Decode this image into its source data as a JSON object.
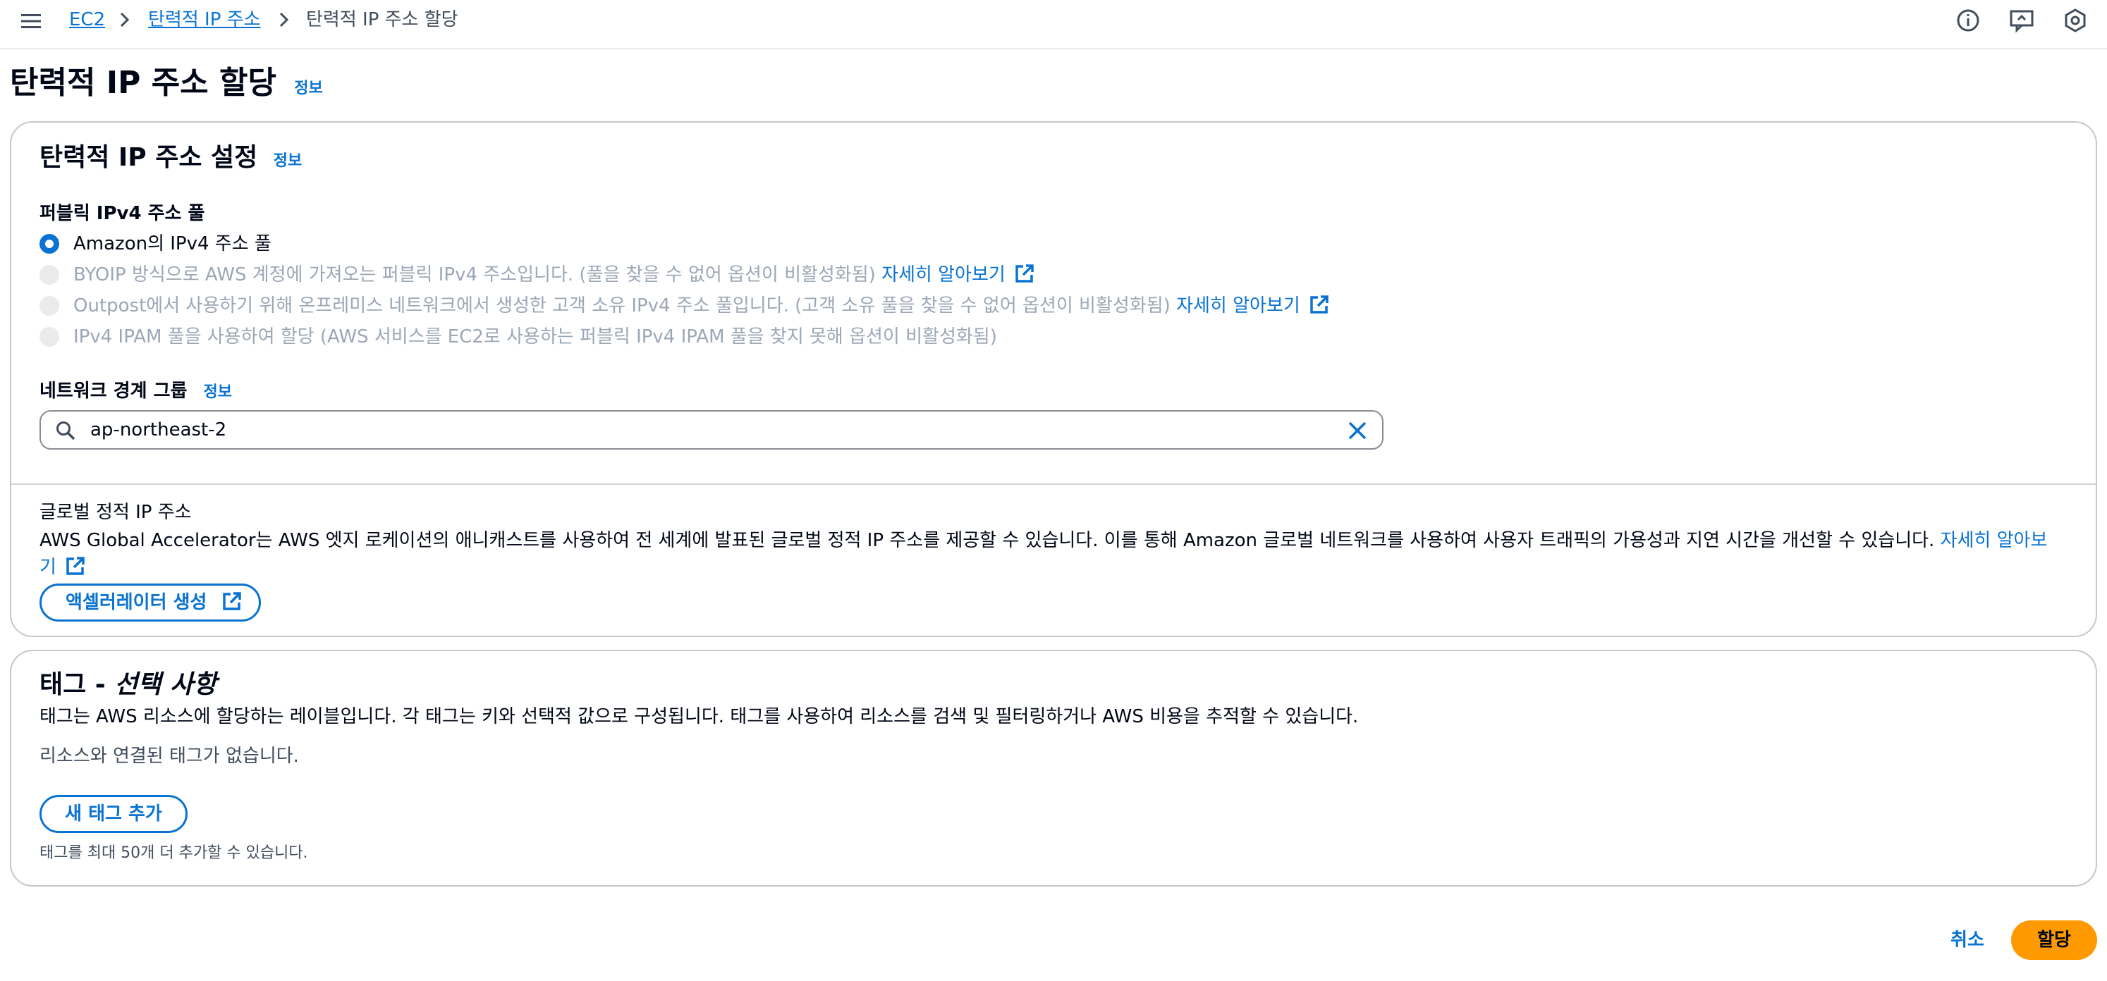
{
  "breadcrumb": {
    "items": [
      "EC2",
      "탄력적 IP 주소",
      "탄력적 IP 주소 할당"
    ]
  },
  "page": {
    "title": "탄력적 IP 주소 할당",
    "info": "정보"
  },
  "settings": {
    "title": "탄력적 IP 주소 설정",
    "info": "정보",
    "pool_label": "퍼블릭 IPv4 주소 풀",
    "options": [
      {
        "text": "Amazon의 IPv4 주소 풀",
        "selected": true,
        "disabled": false
      },
      {
        "text": "BYOIP 방식으로 AWS 계정에 가져오는 퍼블릭 IPv4 주소입니다. (풀을 찾을 수 없어 옵션이 비활성화됨)",
        "link": "자세히 알아보기",
        "selected": false,
        "disabled": true
      },
      {
        "text": "Outpost에서 사용하기 위해 온프레미스 네트워크에서 생성한 고객 소유 IPv4 주소 풀입니다. (고객 소유 풀을 찾을 수 없어 옵션이 비활성화됨)",
        "link": "자세히 알아보기",
        "selected": false,
        "disabled": true
      },
      {
        "text": "IPv4 IPAM 풀을 사용하여 할당 (AWS 서비스를 EC2로 사용하는 퍼블릭 IPv4 IPAM 풀을 찾지 못해 옵션이 비활성화됨)",
        "selected": false,
        "disabled": true
      }
    ],
    "nbg_label": "네트워크 경계 그룹",
    "nbg_info": "정보",
    "nbg_value": "ap-northeast-2",
    "global_title": "글로벌 정적 IP 주소",
    "global_desc": "AWS Global Accelerator는 AWS 엣지 로케이션의 애니캐스트를 사용하여 전 세계에 발표된 글로벌 정적 IP 주소를 제공할 수 있습니다. 이를 통해 Amazon 글로벌 네트워크를 사용하여 사용자 트래픽의 가용성과 지연 시간을 개선할 수 있습니다.",
    "global_link_1": "자세히 알아보",
    "global_link_2": "기",
    "accelerator_button": "액셀러레이터 생성"
  },
  "tags": {
    "title_prefix": "태그 - ",
    "title_italic": "선택 사항",
    "description": "태그는 AWS 리소스에 할당하는 레이블입니다. 각 태그는 키와 선택적 값으로 구성됩니다. 태그를 사용하여 리소스를 검색 및 필터링하거나 AWS 비용을 추적할 수 있습니다.",
    "empty": "리소스와 연결된 태그가 없습니다.",
    "add_button": "새 태그 추가",
    "limit": "태그를 최대 50개 더 추가할 수 있습니다."
  },
  "footer": {
    "cancel": "취소",
    "submit": "할당"
  },
  "colors": {
    "accent": "#0972d3",
    "primary_button": "#ff9900",
    "disabled_text": "#9ba7b6",
    "border": "#c6c6cd"
  },
  "icons": [
    "menu-icon",
    "chevron-right-icon",
    "info-icon",
    "feedback-icon",
    "settings-icon",
    "search-icon",
    "clear-icon",
    "external-link-icon"
  ]
}
